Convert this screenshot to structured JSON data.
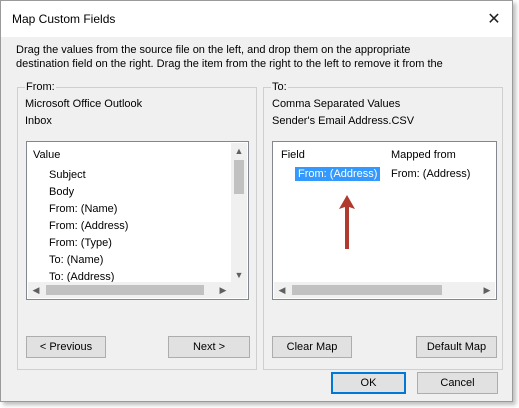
{
  "window": {
    "title": "Map Custom Fields"
  },
  "instructions": "Drag the values from the source file on the left, and drop them on the appropriate\ndestination field on the right.  Drag the item from the right to the left to remove it from the",
  "from": {
    "group_label": "From:",
    "app": "Microsoft Office Outlook",
    "folder": "Inbox",
    "list_header": "Value",
    "items": [
      "Subject",
      "Body",
      "From: (Name)",
      "From: (Address)",
      "From: (Type)",
      "To: (Name)",
      "To: (Address)"
    ],
    "previous_label": "< Previous",
    "next_label": "Next >"
  },
  "to": {
    "group_label": "To:",
    "type": "Comma Separated Values",
    "file": "Sender's Email Address.CSV",
    "col_field": "Field",
    "col_mapped": "Mapped from",
    "rows": [
      {
        "field": "From: (Address)",
        "mapped": "From: (Address)"
      }
    ],
    "clear_map_label": "Clear Map",
    "default_map_label": "Default Map"
  },
  "footer": {
    "ok_label": "OK",
    "cancel_label": "Cancel"
  },
  "colors": {
    "selection": "#3399ff",
    "annotation_arrow": "#b03a2e"
  },
  "icons": {
    "close": "close-icon",
    "scroll_up": "scroll-up-arrow-icon",
    "scroll_down": "scroll-down-arrow-icon",
    "scroll_left": "scroll-left-arrow-icon",
    "scroll_right": "scroll-right-arrow-icon",
    "annotation": "red-up-arrow-icon"
  }
}
